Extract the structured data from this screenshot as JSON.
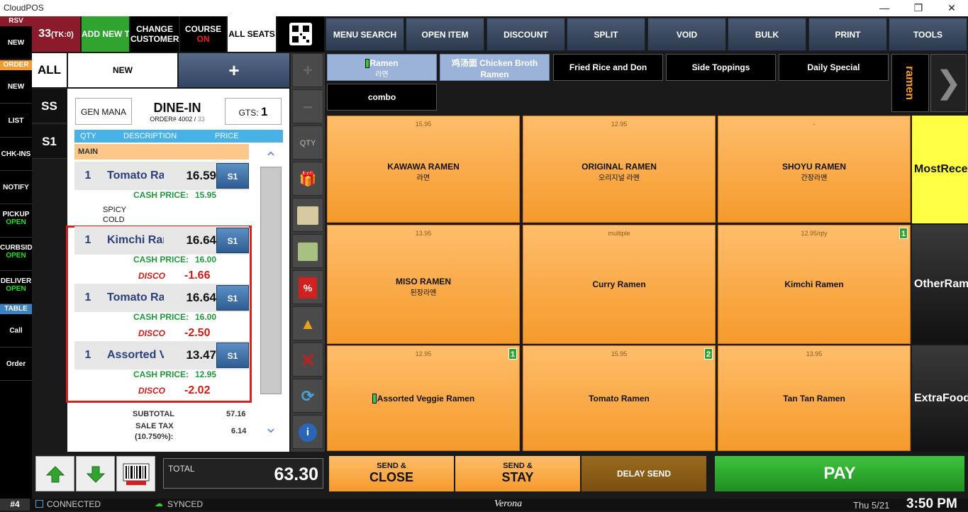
{
  "app": {
    "title": "CloudPOS"
  },
  "left_nav": {
    "rsv": "RSV",
    "rsv_new": "NEW",
    "order": "ORDER",
    "order_new": "NEW",
    "list": "LIST",
    "checkins": "CHK-INS",
    "notify": "NOTIFY",
    "pickup": "PICKUP",
    "pickup_status": "OPEN",
    "curbside": "CURBSID",
    "curbside_status": "OPEN",
    "delivery": "DELIVER",
    "delivery_status": "OPEN",
    "table": "TABLE",
    "call": "Call",
    "order_btn": "Order"
  },
  "top": {
    "table_num": "33",
    "tk": "(TK:0)",
    "add_new": "ADD NEW T",
    "change": "CHANGE",
    "customer": "CUSTOMER",
    "course": "COURSE",
    "course_status": "ON",
    "all_seats": "ALL SEATS"
  },
  "menu_bar": [
    "MENU SEARCH",
    "OPEN ITEM",
    "DISCOUNT",
    "SPLIT",
    "VOID",
    "BULK",
    "PRINT",
    "TOOLS"
  ],
  "seat_tabs": {
    "all": "ALL",
    "new": "NEW",
    "plus": "+",
    "ss": "SS",
    "s1": "S1"
  },
  "ticket": {
    "server": "GEN MANA",
    "type": "DINE-IN",
    "order_label": "ORDER# 4002 / ",
    "order_suffix": "33",
    "guests_label": "GTS:",
    "guests": "1",
    "col_qty": "QTY",
    "col_desc": "DESCRIPTION",
    "col_price": "PRICE",
    "section": "MAIN",
    "items": [
      {
        "qty": "1",
        "name": "Tomato Ramen",
        "price": "16.59",
        "seat": "S1",
        "cash_label": "CASH PRICE:",
        "cash": "15.95",
        "mods": [
          "SPICY",
          "COLD"
        ]
      },
      {
        "qty": "1",
        "name": "Kimchi Ramen",
        "price": "16.64",
        "seat": "S1",
        "cash_label": "CASH PRICE:",
        "cash": "16.00",
        "disc_label": "DISCOUNT",
        "disc": "-1.66"
      },
      {
        "qty": "1",
        "name": "Tomato Ramen",
        "price": "16.64",
        "seat": "S1",
        "cash_label": "CASH PRICE:",
        "cash": "16.00",
        "disc_label": "DISCOUNT",
        "disc": "-2.50"
      },
      {
        "qty": "1",
        "name": "Assorted Veggie Ramen",
        "price": "13.47",
        "seat": "S1",
        "cash_label": "CASH PRICE:",
        "cash": "12.95",
        "disc_label": "DISCOUNT",
        "disc": "-2.02"
      }
    ],
    "subtotal_label": "SUBTOTAL",
    "subtotal": "57.16",
    "tax_label": "SALE TAX",
    "tax_rate": "(10.750%):",
    "tax": "6.14",
    "total_label": "TOTAL",
    "total": "63.30"
  },
  "tools": {
    "qty": "QTY"
  },
  "categories": [
    {
      "label": "Ramen",
      "sub": "라면"
    },
    {
      "label": "鸡汤面 Chicken Broth Ramen"
    },
    {
      "label": "Fried Rice and Don"
    },
    {
      "label": "Side Toppings"
    },
    {
      "label": "Daily Special"
    },
    {
      "label": "combo"
    }
  ],
  "category_vertical": "ramen",
  "tiles": [
    {
      "price": "15.95",
      "name": "KAWAWA RAMEN",
      "kr": "라면"
    },
    {
      "price": "12.95",
      "name": "ORIGINAL RAMEN",
      "kr": "오리지널 라멘"
    },
    {
      "price": "-",
      "name": "SHOYU RAMEN",
      "kr": "간장라멘"
    },
    {
      "price": "13.95",
      "name": "MISO RAMEN",
      "kr": "된장라멘"
    },
    {
      "price": "multiple",
      "name": "Curry Ramen"
    },
    {
      "price": "12.95/qty",
      "name": "Kimchi Ramen",
      "badge": "1"
    },
    {
      "price": "12.95",
      "name": "Assorted Veggie Ramen",
      "badge": "1"
    },
    {
      "price": "15.95",
      "name": "Tomato Ramen",
      "badge": "2"
    },
    {
      "price": "13.95",
      "name": "Tan Tan Ramen"
    }
  ],
  "right_groups": [
    "MostRecent",
    "OtherRamen",
    "ExtraFood"
  ],
  "actions": {
    "send1": "SEND &",
    "close": "CLOSE",
    "send2": "SEND &",
    "stay": "STAY",
    "delay": "DELAY SEND",
    "pay": "PAY"
  },
  "status": {
    "station": "#4",
    "connected": "CONNECTED",
    "synced": "SYNCED",
    "location": "Verona",
    "date": "Thu 5/21",
    "time": "3:50 PM"
  },
  "colors": {
    "orange": "#f59a2c",
    "pay_green": "#2fa52f",
    "highlight_red": "#d32020"
  }
}
